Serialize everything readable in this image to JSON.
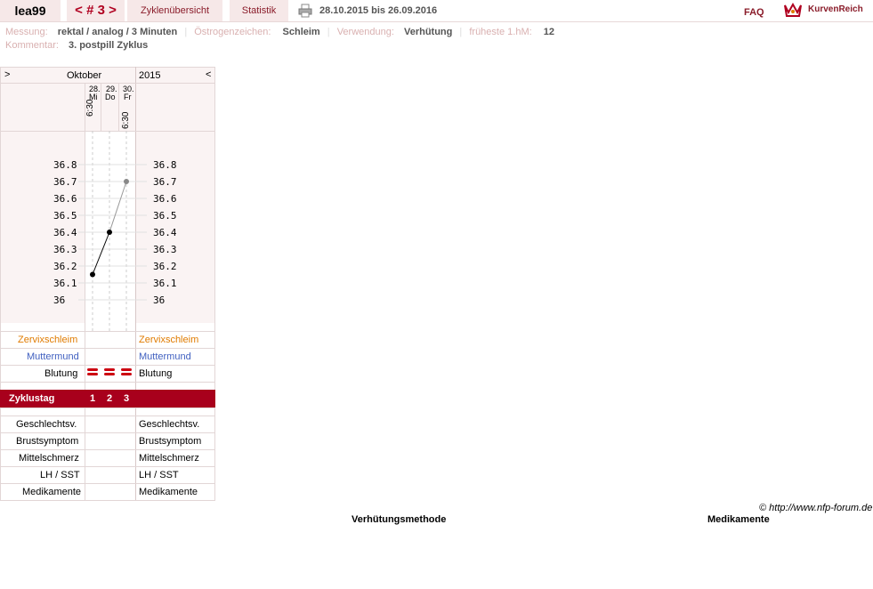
{
  "header": {
    "user": "lea99",
    "nav": "< # 3 >",
    "tabs": [
      "Zyklenübersicht",
      "Statistik"
    ],
    "date_range": "28.10.2015 bis 26.09.2016",
    "faq": "FAQ",
    "logo_text": "KurvenReich"
  },
  "info": {
    "line1": [
      {
        "label": "Messung:",
        "value": "rektal / analog / 3 Minuten"
      },
      {
        "label": "Östrogenzeichen:",
        "value": "Schleim"
      },
      {
        "label": "Verwendung:",
        "value": "Verhütung"
      },
      {
        "label": "früheste 1.hM:",
        "value": "12"
      }
    ],
    "line2": {
      "label": "Kommentar:",
      "value": "3. postpill Zyklus"
    }
  },
  "chart": {
    "nav_left": ">",
    "nav_right": "<",
    "month": "Oktober",
    "year": "2015",
    "days": [
      {
        "date": "28.",
        "weekday": "Mi",
        "time": "6:30"
      },
      {
        "date": "29.",
        "weekday": "Do",
        "time": ""
      },
      {
        "date": "30.",
        "weekday": "Fr",
        "time": "6:30"
      }
    ],
    "temp_ticks": [
      "36.8",
      "36.7",
      "36.6",
      "36.5",
      "36.4",
      "36.3",
      "36.2",
      "36.1",
      "36"
    ],
    "rows": {
      "zervix": "Zervixschleim",
      "muttermund": "Muttermund",
      "blutung": "Blutung",
      "zyklustag": "Zyklustag",
      "gv": "Geschlechtsv.",
      "brust": "Brustsymptom",
      "mittel": "Mittelschmerz",
      "lh": "LH / SST",
      "med": "Medikamente"
    },
    "cycle_days": [
      "1",
      "2",
      "3"
    ],
    "colors": {
      "zervix": "#e07b00",
      "muttermund": "#4060c0",
      "blood": "#cc0010",
      "band": "#a8001c"
    }
  },
  "chart_data": {
    "type": "line",
    "x": [
      "28.",
      "29.",
      "30."
    ],
    "series": [
      {
        "values": [
          36.15,
          36.4,
          36.7
        ]
      }
    ],
    "ylim": [
      36,
      36.8
    ]
  },
  "footer": {
    "copyright": "© http://www.nfp-forum.de",
    "label1": "Verhütungsmethode",
    "label2": "Medikamente"
  }
}
